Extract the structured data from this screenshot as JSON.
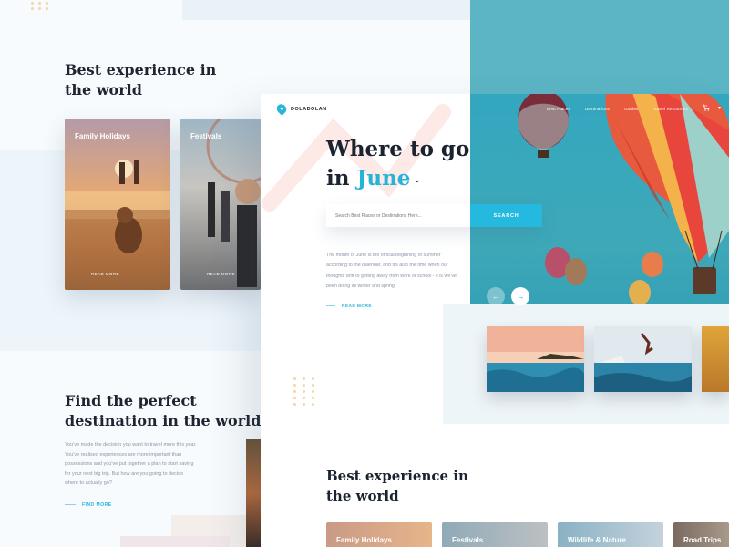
{
  "background_page": {
    "section1_heading": "Best experience in the world",
    "cards": [
      {
        "title": "Family Holidays",
        "link": "READ MORE"
      },
      {
        "title": "Festivals",
        "link": "READ MORE"
      }
    ],
    "section2_heading": "Find the perfect destination in the world",
    "section2_text": "You've made the decision you want to travel more this year. You've realised experiences are more important than possessions and you've put together a plan to start saving for your next big trip. But how are you going to decide where to actually go?",
    "section2_link": "FIND MORE"
  },
  "foreground_page": {
    "brand": "DOLADOLAN",
    "nav": [
      "Best Places",
      "Destinations",
      "Guides",
      "Travel Resources"
    ],
    "headline_line1": "Where to go",
    "headline_in": "in",
    "headline_month": "June",
    "search": {
      "placeholder": "Search Best Places or Destinations Here...",
      "button": "SEARCH"
    },
    "description": "The month of June is the official beginning of summer according to the calendar, and it's also the time when our thoughts drift to getting away from work or school - it is we've been doing all winter and spring.",
    "read_more": "READ MORE",
    "section_heading": "Best experience in the world",
    "cards": [
      "Family Holidays",
      "Festivals",
      "Wildlife & Nature",
      "Road Trips"
    ]
  },
  "icons": [
    "map-pin-icon",
    "cart-icon",
    "chevron-down-icon",
    "arrow-left-icon",
    "arrow-right-icon"
  ],
  "colors": {
    "accent": "#26b9df",
    "teal": "#5bb5c4",
    "badge": "#f04e5e",
    "heading": "#1b2230"
  }
}
